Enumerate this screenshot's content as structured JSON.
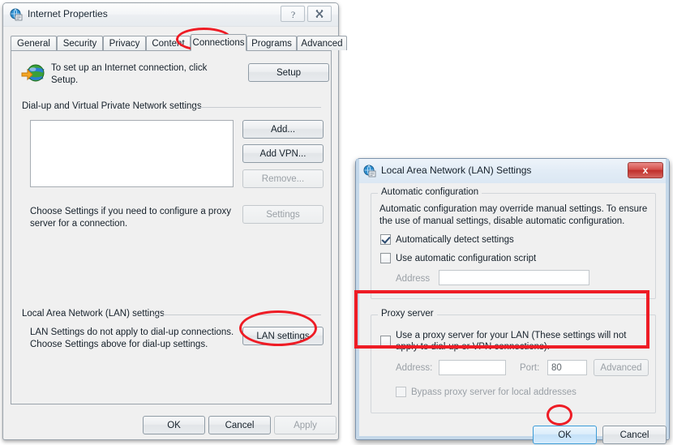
{
  "internet_properties": {
    "title": "Internet Properties",
    "title_icon": "internet-properties-icon",
    "help_button": "?",
    "close_button": "✖",
    "tabs": [
      {
        "label": "General",
        "selected": false
      },
      {
        "label": "Security",
        "selected": false
      },
      {
        "label": "Privacy",
        "selected": false
      },
      {
        "label": "Content",
        "selected": false
      },
      {
        "label": "Connections",
        "selected": true
      },
      {
        "label": "Programs",
        "selected": false
      },
      {
        "label": "Advanced",
        "selected": false
      }
    ],
    "setup": {
      "text": "To set up an Internet connection, click Setup.",
      "button": "Setup",
      "icon": "globe-with-arrow-icon"
    },
    "dialup_group": {
      "label": "Dial-up and Virtual Private Network settings",
      "list_items": [],
      "buttons": [
        {
          "label": "Add...",
          "enabled": true
        },
        {
          "label": "Add VPN...",
          "enabled": true
        },
        {
          "label": "Remove...",
          "enabled": false
        },
        {
          "label": "Settings",
          "enabled": false
        }
      ],
      "hint": "Choose Settings if you need to configure a proxy server for a connection."
    },
    "lan_group": {
      "label": "Local Area Network (LAN) settings",
      "hint": "LAN Settings do not apply to dial-up connections. Choose Settings above for dial-up settings.",
      "button": "LAN settings"
    },
    "footer": [
      {
        "label": "OK",
        "enabled": true
      },
      {
        "label": "Cancel",
        "enabled": true
      },
      {
        "label": "Apply",
        "enabled": false
      }
    ]
  },
  "lan_settings": {
    "title": "Local Area Network (LAN) Settings",
    "title_icon": "internet-properties-icon",
    "close_button": "x",
    "automatic_configuration": {
      "group_label": "Automatic configuration",
      "description": "Automatic configuration may override manual settings.  To ensure the use of manual settings, disable automatic configuration.",
      "auto_detect": {
        "label": "Automatically detect settings",
        "checked": true,
        "enabled": true
      },
      "use_script": {
        "label": "Use automatic configuration script",
        "checked": false,
        "enabled": true
      },
      "address_label": "Address",
      "address_value": ""
    },
    "proxy_server": {
      "group_label": "Proxy server",
      "use_proxy": {
        "label": "Use a proxy server for your LAN (These settings will not apply to dial-up or VPN connections).",
        "checked": false,
        "enabled": true
      },
      "address_label": "Address:",
      "address_value": "",
      "port_label": "Port:",
      "port_value": "80",
      "advanced_button": "Advanced",
      "bypass": {
        "label": "Bypass proxy server for local addresses",
        "checked": false,
        "enabled": false
      }
    },
    "footer": [
      {
        "label": "OK",
        "default": true
      },
      {
        "label": "Cancel",
        "default": false
      }
    ]
  },
  "annotations": {
    "color": "#ee1c25",
    "ellipse_connections_tab": "highlight-connections-tab",
    "ellipse_lan_settings_button": "highlight-lan-settings-button",
    "ellipse_ok_button": "highlight-ok-button",
    "box_proxy_server": "highlight-proxy-server-section"
  }
}
